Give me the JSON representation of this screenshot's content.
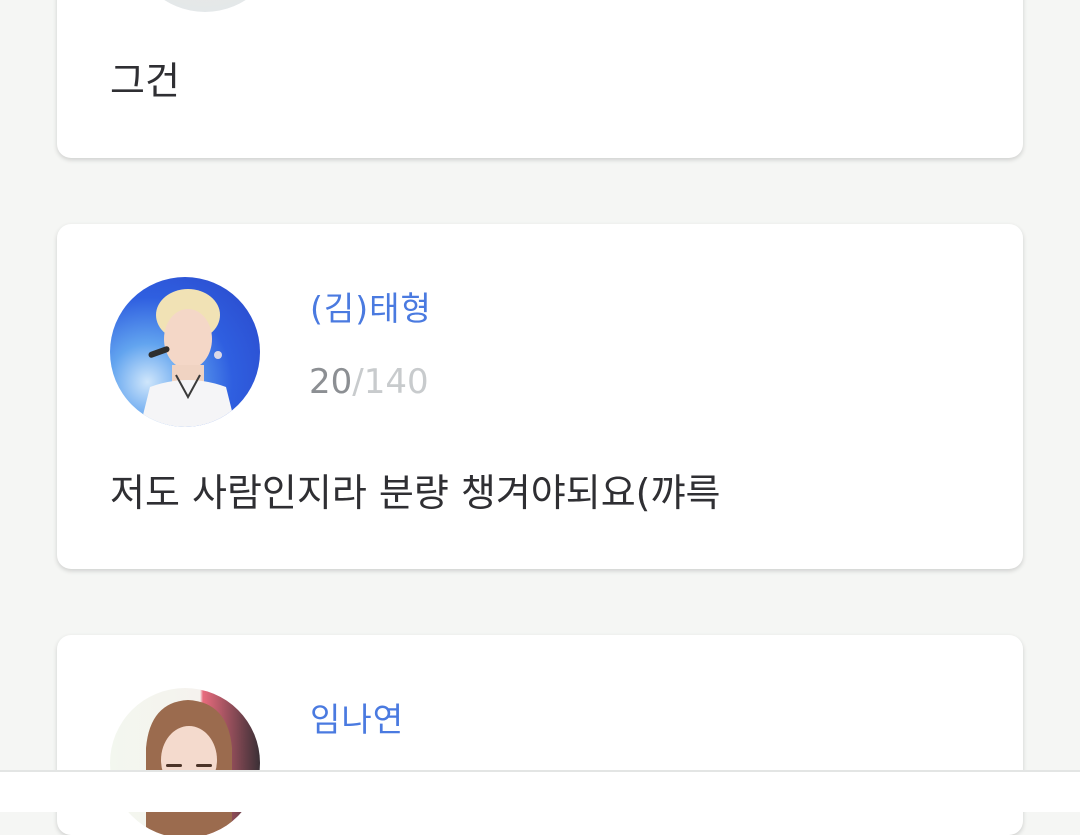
{
  "posts": [
    {
      "avatar_icon": "profile-photo",
      "text": "그건"
    },
    {
      "name": "(김)태형",
      "count": "20",
      "separator": "/",
      "max": "140",
      "avatar_icon": "profile-photo",
      "text": "저도 사람인지라 분량 챙겨야되요(꺄륵"
    },
    {
      "name": "임나연",
      "avatar_icon": "profile-photo"
    }
  ],
  "colors": {
    "background": "#f5f6f4",
    "card": "#ffffff",
    "name": "#4a7ae0",
    "text": "#2f2f33",
    "counter": "#8c8f93"
  }
}
